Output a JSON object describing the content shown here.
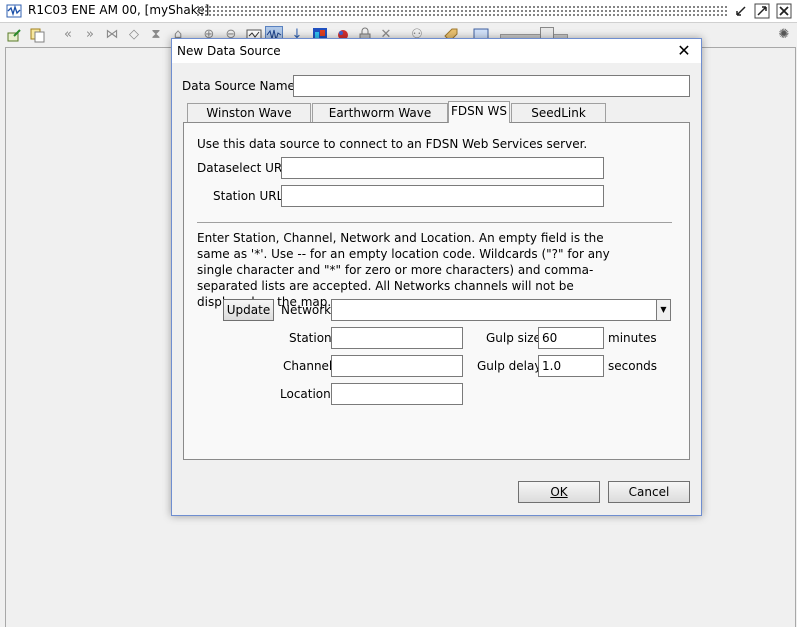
{
  "frame": {
    "title": "R1C03 ENE AM 00, [myShake]"
  },
  "toolbar": {
    "icons": [
      "export-icon",
      "copy-icon",
      "rewind-icon",
      "fast-forward-icon",
      "shrink-icon",
      "expand-icon",
      "hourglass-icon",
      "home-icon",
      "zoom-in-icon",
      "zoom-out-icon",
      "filter-icon",
      "waveform-icon",
      "arrow-down-icon",
      "spectrogram-icon",
      "particle-motion-icon",
      "lock-icon",
      "close-icon",
      "network-icon",
      "tag-icon",
      "screen-icon",
      "slider-icon",
      "busy-icon"
    ]
  },
  "dialog": {
    "title": "New Data Source",
    "name_label": "Data Source Name:",
    "name_value": "",
    "tabs": [
      {
        "label": "Winston Wave Server"
      },
      {
        "label": "Earthworm Wave Server"
      },
      {
        "label": "FDSN WS"
      },
      {
        "label": "SeedLink Server"
      }
    ],
    "active_tab": "FDSN WS",
    "fdsn": {
      "intro": "Use this data source to connect to an FDSN Web Services server.",
      "dataselect_label": "Dataselect URL",
      "dataselect_value": "",
      "station_url_label": "Station URL",
      "station_url_value": "",
      "instructions": "Enter Station, Channel, Network and Location. An empty field is the same as '*'. Use -- for an empty location code. Wildcards (\"?\" for any single character and \"*\" for zero or more characters) and comma-separated lists are accepted. All Networks channels will not be displayed on the map.",
      "update_button": "Update",
      "network_label": "Network",
      "network_value": "",
      "station_label": "Station",
      "station_value": "",
      "channel_label": "Channel",
      "channel_value": "",
      "location_label": "Location",
      "location_value": "",
      "gulp_size_label": "Gulp size",
      "gulp_size_value": "60",
      "gulp_size_unit": "minutes",
      "gulp_delay_label": "Gulp delay",
      "gulp_delay_value": "1.0",
      "gulp_delay_unit": "seconds"
    },
    "ok_button": "OK",
    "cancel_button": "Cancel"
  },
  "colors": {
    "dialog_border": "#6f8ed0",
    "background": "#f0f0f0",
    "panel": "#f9f9f9"
  }
}
